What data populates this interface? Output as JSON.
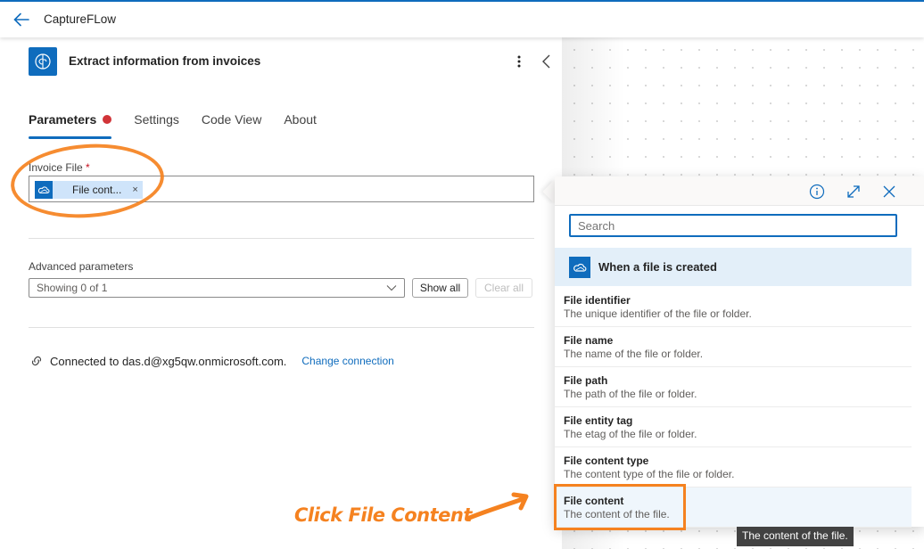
{
  "topbar": {
    "title": "CaptureFLow",
    "back_icon": "arrow-left-icon"
  },
  "panel": {
    "action_title": "Extract information from invoices",
    "action_icon": "ai-brain-icon",
    "tabs": [
      {
        "label": "Parameters",
        "active": true,
        "has_error": true
      },
      {
        "label": "Settings",
        "active": false
      },
      {
        "label": "Code View",
        "active": false
      },
      {
        "label": "About",
        "active": false
      }
    ],
    "invoice_field": {
      "label": "Invoice File",
      "required_mark": "*",
      "token": {
        "label": "File cont...",
        "icon": "onedrive-icon",
        "remove": "×"
      }
    },
    "advanced": {
      "label": "Advanced parameters",
      "select_value": "Showing 0 of 1",
      "show_all": "Show all",
      "clear_all": "Clear all"
    },
    "connection": {
      "text": "Connected to das.d@xg5qw.onmicrosoft.com.",
      "change_link": "Change connection"
    }
  },
  "popup": {
    "search_placeholder": "Search",
    "group_label": "When a file is created",
    "items": [
      {
        "title": "File identifier",
        "desc": "The unique identifier of the file or folder."
      },
      {
        "title": "File name",
        "desc": "The name of the file or folder."
      },
      {
        "title": "File path",
        "desc": "The path of the file or folder."
      },
      {
        "title": "File entity tag",
        "desc": "The etag of the file or folder."
      },
      {
        "title": "File content type",
        "desc": "The content type of the file or folder."
      },
      {
        "title": "File content",
        "desc": "The content of the file."
      }
    ],
    "tooltip": "The content of the file."
  },
  "annotation": {
    "text": "Click File Content",
    "color": "#f58220"
  },
  "colors": {
    "accent": "#0f6cbd",
    "error_dot": "#d13438",
    "annotation": "#f58220"
  }
}
